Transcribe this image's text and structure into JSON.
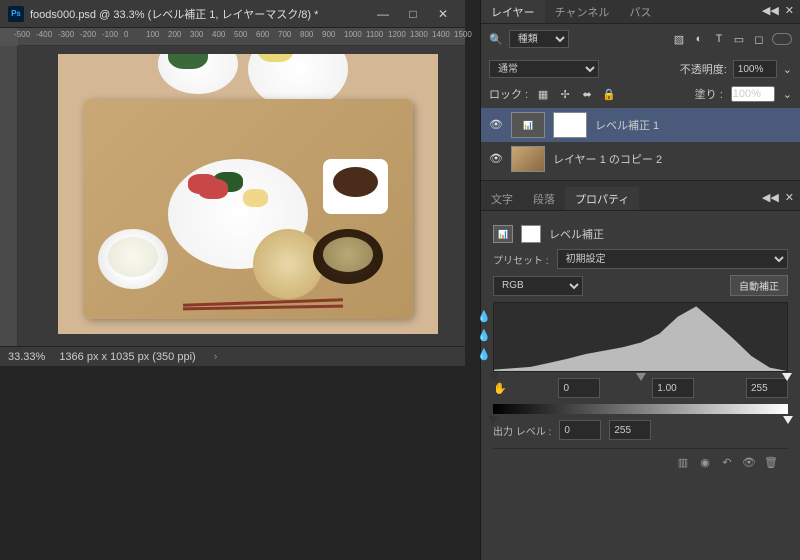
{
  "doc": {
    "tab_title": "foods000.psd @ 33.3% (レベル補正 1, レイヤーマスク/8) *",
    "zoom": "33.33%",
    "dimensions": "1366 px x 1035 px (350 ppi)"
  },
  "ruler_ticks": [
    "-500",
    "-400",
    "-300",
    "-200",
    "-100",
    "0",
    "100",
    "200",
    "300",
    "400",
    "500",
    "600",
    "700",
    "800",
    "900",
    "1000",
    "1100",
    "1200",
    "1300",
    "1400",
    "1500"
  ],
  "layers_panel": {
    "tabs": [
      "レイヤー",
      "チャンネル",
      "パス"
    ],
    "filter_label": "種類",
    "blend_mode": "通常",
    "opacity_label": "不透明度:",
    "opacity": "100%",
    "lock_label": "ロック :",
    "fill_label": "塗り :",
    "fill": "100%",
    "layers": [
      {
        "name": "レベル補正 1",
        "type": "adjustment",
        "selected": true
      },
      {
        "name": "レイヤー 1 のコピー 2",
        "type": "image",
        "selected": false
      }
    ]
  },
  "props_panel": {
    "tabs": [
      "文字",
      "段落",
      "プロパティ"
    ],
    "title": "レベル補正",
    "preset_label": "プリセット :",
    "preset": "初期設定",
    "channel": "RGB",
    "auto_btn": "自動補正",
    "shadows": "0",
    "midtones": "1.00",
    "highlights": "255",
    "output_label": "出力 レベル :",
    "out_black": "0",
    "out_white": "255"
  },
  "chart_data": {
    "type": "area",
    "title": "",
    "xlabel": "",
    "ylabel": "",
    "xlim": [
      0,
      255
    ],
    "ylim": [
      0,
      1
    ],
    "x": [
      0,
      16,
      32,
      48,
      64,
      80,
      96,
      112,
      128,
      144,
      160,
      176,
      192,
      208,
      224,
      240,
      255
    ],
    "values": [
      0.02,
      0.04,
      0.06,
      0.12,
      0.18,
      0.25,
      0.3,
      0.35,
      0.42,
      0.55,
      0.8,
      0.95,
      0.72,
      0.48,
      0.22,
      0.05,
      0.0
    ]
  }
}
